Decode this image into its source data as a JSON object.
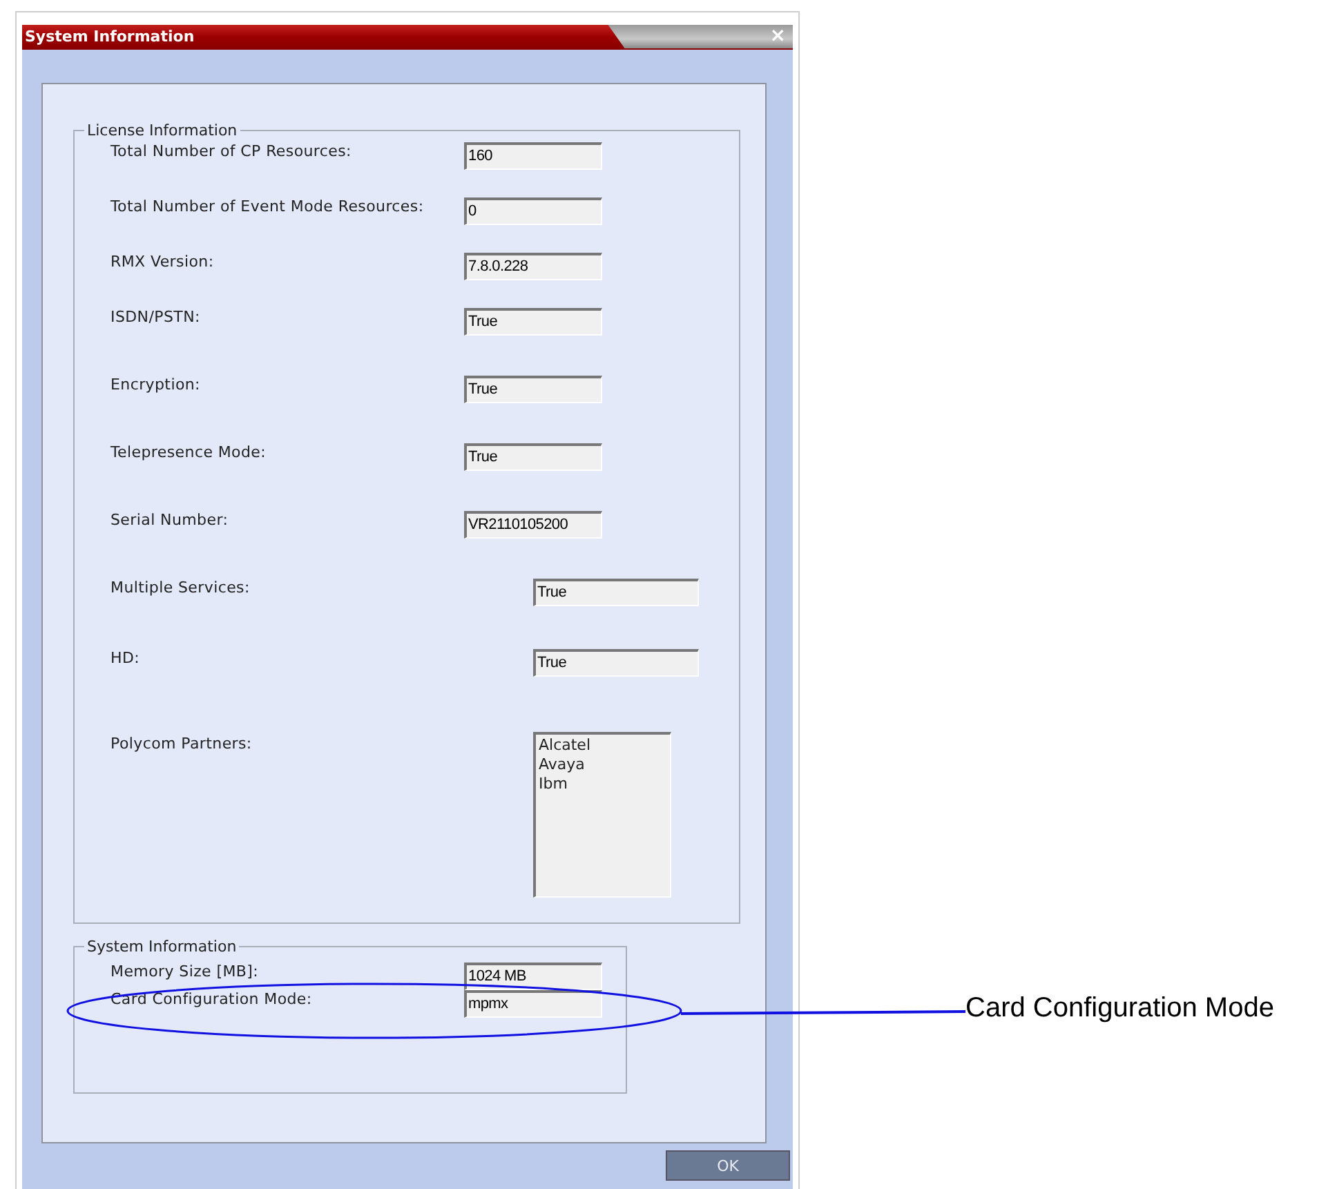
{
  "window": {
    "title": "System Information",
    "close": "×"
  },
  "license": {
    "legend": "License Information",
    "rows": [
      {
        "label": "Total Number of CP Resources:",
        "kind": "field",
        "value": "160"
      },
      {
        "label": "Total Number of Event Mode Resources:",
        "kind": "field",
        "value": "0"
      },
      {
        "label": "RMX Version:",
        "kind": "field",
        "value": "7.8.0.228"
      },
      {
        "label": "ISDN/PSTN:",
        "kind": "field",
        "value": "True"
      },
      {
        "label": "Encryption:",
        "kind": "field",
        "value": "True"
      },
      {
        "label": "Telepresence Mode:",
        "kind": "field",
        "value": "True"
      },
      {
        "label": "Serial Number:",
        "kind": "field",
        "value": "VR2110105200"
      },
      {
        "label": "Multiple Services:",
        "kind": "wide-field",
        "value": "True"
      },
      {
        "label": "HD:",
        "kind": "wide-field",
        "value": "True"
      },
      {
        "label": "Polycom Partners:",
        "kind": "list",
        "items": [
          "Alcatel",
          "Avaya",
          "Ibm"
        ]
      }
    ]
  },
  "system": {
    "legend": "System Information",
    "rows": [
      {
        "label": "Memory Size [MB]:",
        "kind": "field",
        "value": "1024 MB"
      },
      {
        "label": "Card Configuration Mode:",
        "kind": "field",
        "value": "mpmx"
      }
    ]
  },
  "buttons": [
    "OK"
  ],
  "callout": {
    "text": "Card Configuration Mode"
  }
}
